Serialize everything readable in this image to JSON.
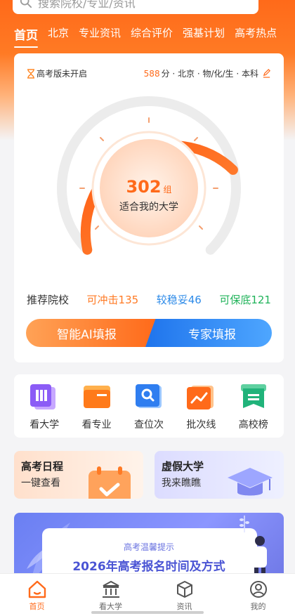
{
  "header": {
    "search_placeholder": "搜索院校/专业/资讯",
    "tabs": [
      {
        "label": "首页",
        "active": true
      },
      {
        "label": "北京"
      },
      {
        "label": "专业资讯"
      },
      {
        "label": "综合评价"
      },
      {
        "label": "强基计划"
      },
      {
        "label": "高考热点"
      }
    ]
  },
  "score_card": {
    "version_status": "高考版未开启",
    "score": "588",
    "score_suffix": "分 · 北京 · 物/化/生 · 本科",
    "match_count": "302",
    "match_unit": "组",
    "match_label": "适合我的大学",
    "recommend_label": "推荐院校",
    "reach": "可冲击135",
    "stable": "较稳妥46",
    "safe": "可保底121",
    "ai_button": "智能AI填报",
    "expert_button": "专家填报"
  },
  "quick_actions": [
    {
      "label": "看大学",
      "icon": "university-icon"
    },
    {
      "label": "看专业",
      "icon": "major-icon"
    },
    {
      "label": "查位次",
      "icon": "rank-search-icon"
    },
    {
      "label": "批次线",
      "icon": "batch-line-icon"
    },
    {
      "label": "高校榜",
      "icon": "ranking-icon"
    }
  ],
  "promos": [
    {
      "title": "高考日程",
      "subtitle": "一键查看"
    },
    {
      "title": "虚假大学",
      "subtitle": "我来瞧瞧"
    }
  ],
  "banner": {
    "kicker": "高考温馨提示",
    "title": "2026年高考报名时间及方式"
  },
  "tabbar": [
    {
      "label": "首页",
      "active": true
    },
    {
      "label": "看大学"
    },
    {
      "label": "资讯"
    },
    {
      "label": "我的"
    }
  ],
  "colors": {
    "accent": "#ff6a1a",
    "blue": "#2c8ae8",
    "green": "#20b35a"
  }
}
